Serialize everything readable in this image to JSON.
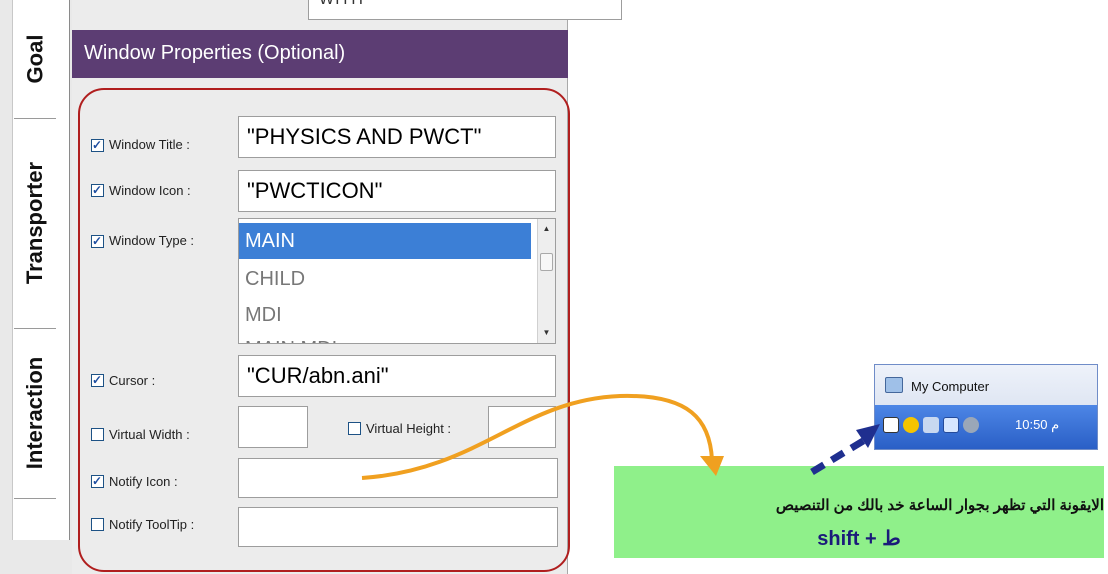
{
  "tabs": [
    "Goal",
    "Transporter",
    "Interaction"
  ],
  "top_field_value": "WITH",
  "header_title": "Window Properties (Optional)",
  "fields": {
    "window_title": {
      "label": "Window Title :",
      "checked": true,
      "value": "\"PHYSICS AND PWCT\""
    },
    "window_icon": {
      "label": "Window Icon :",
      "checked": true,
      "value": "\"PWCTICON\""
    },
    "window_type": {
      "label": "Window Type :",
      "checked": true
    },
    "cursor": {
      "label": "Cursor :",
      "checked": true,
      "value": "\"CUR/abn.ani\""
    },
    "virtual_width": {
      "label": "Virtual Width :",
      "checked": false,
      "value": ""
    },
    "virtual_height": {
      "label": "Virtual Height :",
      "checked": false,
      "value": ""
    },
    "notify_icon": {
      "label": "Notify Icon :",
      "checked": true,
      "value": ""
    },
    "notify_tooltip": {
      "label": "Notify ToolTip :",
      "checked": false,
      "value": ""
    }
  },
  "window_type_options": [
    "MAIN",
    "CHILD",
    "MDI",
    "MAIN MDI"
  ],
  "window_type_selected": "MAIN",
  "tray": {
    "menu_item": "My Computer",
    "clock": "10:50 م"
  },
  "note": {
    "arabic": "الايقونة التي تظهر بجوار الساعة  خد بالك من التنصيص",
    "shortcut": "shift + ط"
  },
  "colors": {
    "header_bg": "#5c3d73",
    "red_frame": "#b01e1e",
    "selection": "#3c7fd6",
    "note_bg": "#8ff08a",
    "orange_arrow": "#f0a020",
    "blue_arrow": "#1f2f8f"
  }
}
